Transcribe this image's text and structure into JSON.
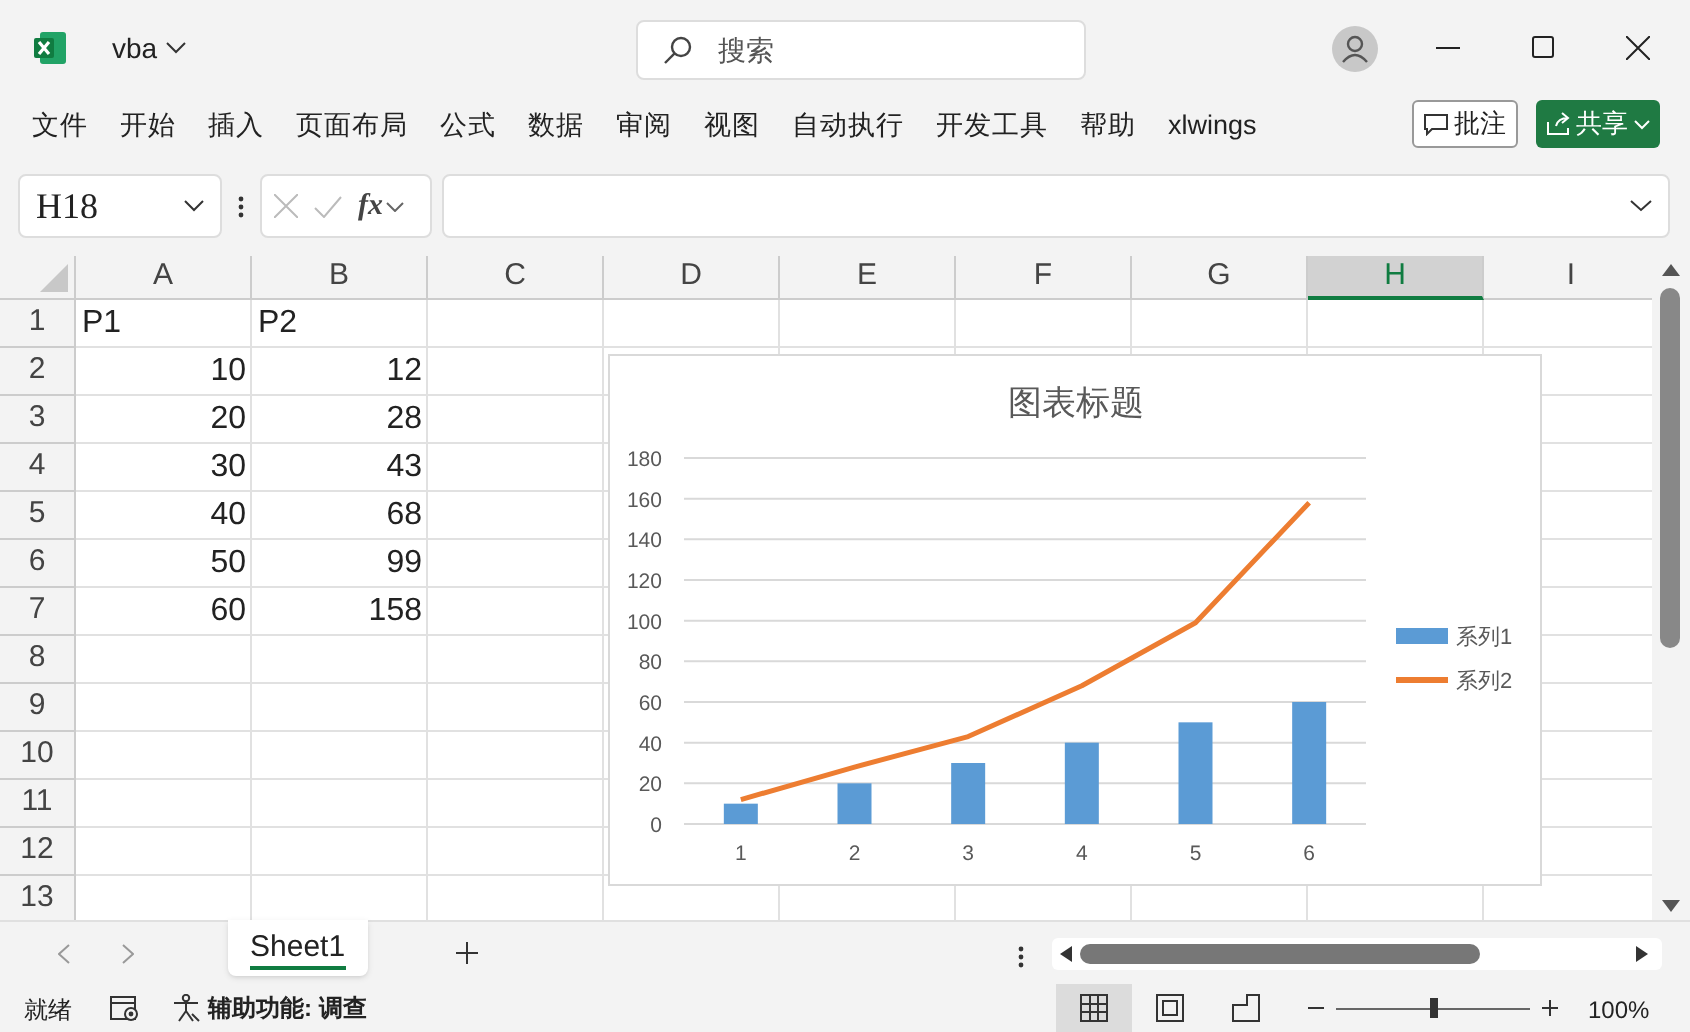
{
  "window": {
    "title": "vba"
  },
  "search": {
    "placeholder": "搜索"
  },
  "ribbon_tabs": [
    "文件",
    "开始",
    "插入",
    "页面布局",
    "公式",
    "数据",
    "审阅",
    "视图",
    "自动执行",
    "开发工具",
    "帮助",
    "xlwings"
  ],
  "ribbon_buttons": {
    "comments": "批注",
    "share": "共享"
  },
  "formula_bar": {
    "name_box": "H18",
    "function_label": "fx"
  },
  "sheet": {
    "columns": [
      {
        "label": "A",
        "selected": false
      },
      {
        "label": "B",
        "selected": false
      },
      {
        "label": "C",
        "selected": false
      },
      {
        "label": "D",
        "selected": false
      },
      {
        "label": "E",
        "selected": false
      },
      {
        "label": "F",
        "selected": false
      },
      {
        "label": "G",
        "selected": false
      },
      {
        "label": "H",
        "selected": true
      },
      {
        "label": "I",
        "selected": false
      }
    ],
    "rows": [
      {
        "label": "1",
        "cells": [
          {
            "text": "P1",
            "kind": "text"
          },
          {
            "text": "P2",
            "kind": "text"
          }
        ]
      },
      {
        "label": "2",
        "cells": [
          {
            "text": "10",
            "kind": "number"
          },
          {
            "text": "12",
            "kind": "number"
          }
        ]
      },
      {
        "label": "3",
        "cells": [
          {
            "text": "20",
            "kind": "number"
          },
          {
            "text": "28",
            "kind": "number"
          }
        ]
      },
      {
        "label": "4",
        "cells": [
          {
            "text": "30",
            "kind": "number"
          },
          {
            "text": "43",
            "kind": "number"
          }
        ]
      },
      {
        "label": "5",
        "cells": [
          {
            "text": "40",
            "kind": "number"
          },
          {
            "text": "68",
            "kind": "number"
          }
        ]
      },
      {
        "label": "6",
        "cells": [
          {
            "text": "50",
            "kind": "number"
          },
          {
            "text": "99",
            "kind": "number"
          }
        ]
      },
      {
        "label": "7",
        "cells": [
          {
            "text": "60",
            "kind": "number"
          },
          {
            "text": "158",
            "kind": "number"
          }
        ]
      },
      {
        "label": "8",
        "cells": []
      },
      {
        "label": "9",
        "cells": []
      },
      {
        "label": "10",
        "cells": []
      },
      {
        "label": "11",
        "cells": []
      },
      {
        "label": "12",
        "cells": []
      },
      {
        "label": "13",
        "cells": []
      }
    ]
  },
  "chart": {
    "chart_data": {
      "type": "bar",
      "grid": true,
      "legend": "right",
      "title": "图表标题",
      "categories": [
        "1",
        "2",
        "3",
        "4",
        "5",
        "6"
      ],
      "ylim": [
        0,
        180
      ],
      "yticks": [
        0,
        20,
        40,
        60,
        80,
        100,
        120,
        140,
        160,
        180
      ],
      "series": [
        {
          "name": "系列1",
          "color": "#5b9bd5",
          "values": [
            10,
            20,
            30,
            40,
            50,
            60
          ]
        },
        {
          "name": "系列2",
          "type": "line",
          "color": "#ed7d31",
          "values": [
            12,
            28,
            43,
            68,
            99,
            158
          ]
        }
      ]
    }
  },
  "sheet_tabs": [
    {
      "label": "Sheet1",
      "selected": true
    }
  ],
  "status_bar": {
    "ready": "就绪",
    "accessibility": "辅助功能: 调查",
    "views": [
      {
        "kind": "normal",
        "selected": true
      },
      {
        "kind": "page_layout",
        "selected": false
      },
      {
        "kind": "page_break",
        "selected": false
      }
    ],
    "zoom": {
      "level": 0.5,
      "reading": "100%"
    }
  }
}
